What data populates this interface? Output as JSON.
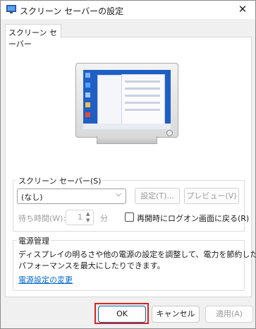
{
  "window": {
    "title": "スクリーン セーバーの設定",
    "close_glyph": "✕"
  },
  "tabs": [
    {
      "label": "スクリーン セーバー",
      "active": true
    }
  ],
  "screensaver_group": {
    "label": "スクリーン セーバー(S)",
    "selected": "(なし)",
    "settings_button": "設定(T)...",
    "preview_button": "プレビュー(V)",
    "wait_label": "待ち時間(W):",
    "wait_value": "1",
    "wait_unit": "分",
    "resume_logon_label": "再開時にログオン画面に戻る(R)",
    "resume_logon_checked": false
  },
  "power_group": {
    "label": "電源管理",
    "description_line1": "ディスプレイの明るさや他の電源の設定を調整して、電力を節約したり",
    "description_line2": "パフォーマンスを最大にしたりできます。",
    "link": "電源設定の変更"
  },
  "footer": {
    "ok": "OK",
    "cancel": "キャンセル",
    "apply": "適用(A)"
  },
  "colors": {
    "ok_highlight": "#d7261e",
    "link": "#0066cc",
    "desktop": "#1f5fc4"
  }
}
